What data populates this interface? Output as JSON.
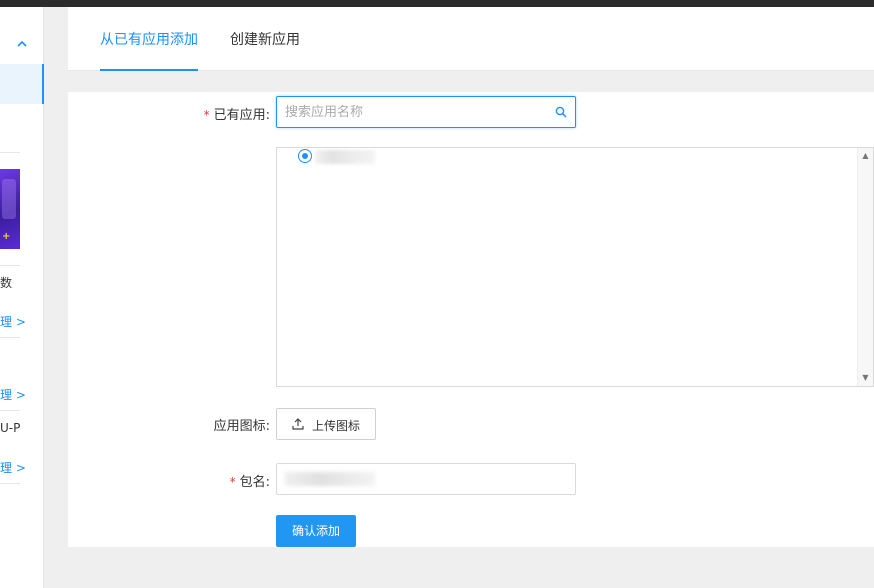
{
  "tabs": [
    {
      "label": "从已有应用添加",
      "active": true
    },
    {
      "label": "创建新应用",
      "active": false
    }
  ],
  "sidebar": {
    "collapse_icon": "chevron-up-icon",
    "texts": [
      "数",
      "U-P"
    ],
    "links": [
      "理 >",
      "理 >",
      "理 >"
    ],
    "banner_icon": "+"
  },
  "form": {
    "existing_app_label": "已有应用:",
    "required_mark": "*",
    "search_placeholder": "搜索应用名称",
    "search_icon": "search-icon",
    "app_icon_label": "应用图标:",
    "upload_label": "上传图标",
    "upload_icon": "upload-icon",
    "package_label": "包名:",
    "confirm_label": "确认添加"
  },
  "colors": {
    "accent": "#1e90ff",
    "primary_button": "#2196f3",
    "required": "#e4393c",
    "background": "#efefef"
  }
}
